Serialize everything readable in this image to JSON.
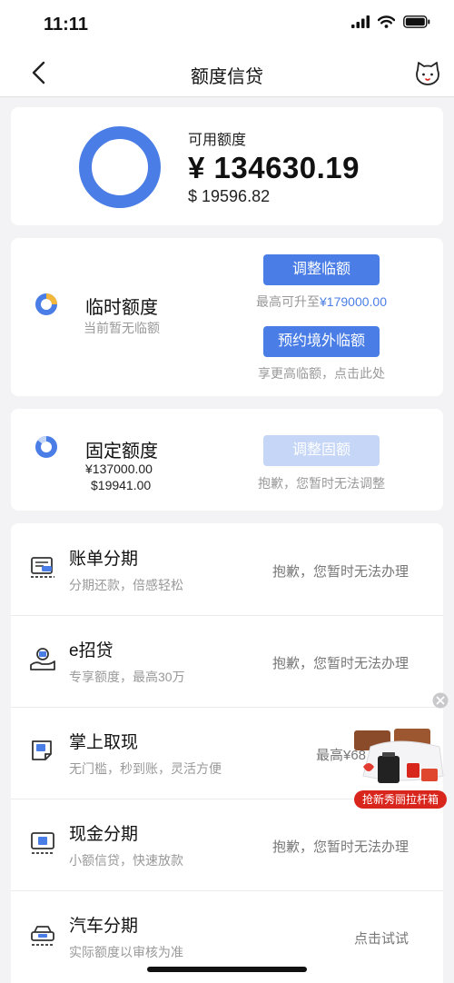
{
  "status_bar": {
    "time": "11:11"
  },
  "nav": {
    "title": "额度信贷"
  },
  "summary": {
    "label": "可用额度",
    "amount_cny": "¥ 134630.19",
    "amount_usd": "$ 19596.82",
    "ring_color": "#4a7ee6"
  },
  "temp_limit": {
    "title": "临时额度",
    "subtitle": "当前暂无临额",
    "adjust_button": "调整临额",
    "max_prefix": "最高可升至",
    "max_value": "¥179000.00",
    "reserve_button": "预约境外临额",
    "reserve_note": "享更高临额，点击此处"
  },
  "fixed_limit": {
    "title": "固定额度",
    "amount_cny": "¥137000.00",
    "amount_usd": "$19941.00",
    "adjust_button": "调整固额",
    "note": "抱歉，您暂时无法调整"
  },
  "services": [
    {
      "icon": "bill-installment-icon",
      "title": "账单分期",
      "subtitle": "分期还款，倍感轻松",
      "status": "抱歉，您暂时无法办理"
    },
    {
      "icon": "loan-hand-icon",
      "title": "e招贷",
      "subtitle": "专享额度，最高30万",
      "status": "抱歉，您暂时无法办理"
    },
    {
      "icon": "cash-withdraw-icon",
      "title": "掌上取现",
      "subtitle": "无门槛，秒到账，灵活方便",
      "status": "最高¥68"
    },
    {
      "icon": "cash-installment-icon",
      "title": "现金分期",
      "subtitle": "小额信贷，快速放款",
      "status": "抱歉，您暂时无法办理"
    },
    {
      "icon": "car-icon",
      "title": "汽车分期",
      "subtitle": "实际额度以审核为准",
      "status": "点击试试"
    }
  ],
  "promo": {
    "label": "抢新秀丽拉杆箱"
  },
  "colors": {
    "accent": "#4a7ee6",
    "accent_disabled": "#c5d6f7",
    "promo_red": "#d9261c"
  }
}
